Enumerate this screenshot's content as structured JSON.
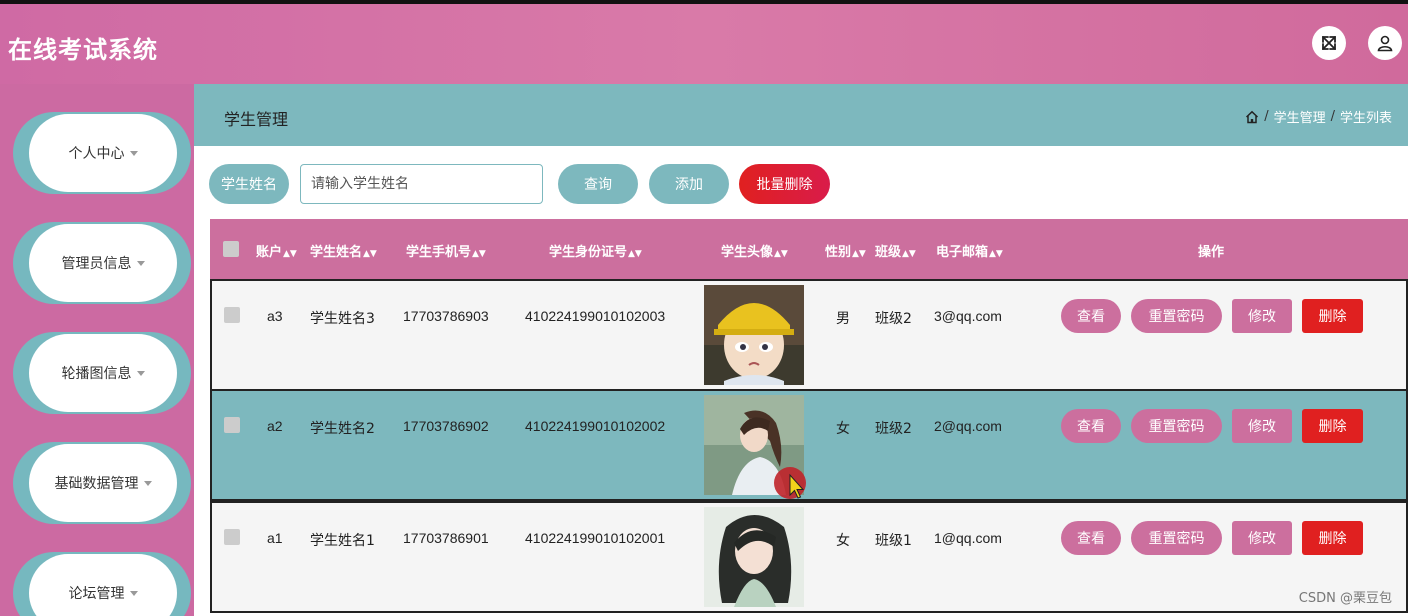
{
  "app": {
    "title": "在线考试系统"
  },
  "header": {
    "fullscreen_icon": "expand-icon",
    "user_icon": "user-icon"
  },
  "sidebar": {
    "items": [
      {
        "label": "个人中心"
      },
      {
        "label": "管理员信息"
      },
      {
        "label": "轮播图信息"
      },
      {
        "label": "基础数据管理"
      },
      {
        "label": "论坛管理"
      }
    ]
  },
  "page": {
    "title": "学生管理",
    "breadcrumb": [
      "学生管理",
      "学生列表"
    ]
  },
  "search": {
    "label": "学生姓名",
    "placeholder": "请输入学生姓名",
    "query_label": "查询",
    "add_label": "添加",
    "batch_delete_label": "批量删除"
  },
  "table": {
    "headers": {
      "account": "账户",
      "name": "学生姓名",
      "phone": "学生手机号",
      "id_card": "学生身份证号",
      "avatar": "学生头像",
      "gender": "性别",
      "class": "班级",
      "email": "电子邮箱",
      "actions": "操作"
    },
    "actions": {
      "view": "查看",
      "reset": "重置密码",
      "edit": "修改",
      "delete": "删除"
    },
    "rows": [
      {
        "account": "a3",
        "name": "学生姓名3",
        "phone": "17703786903",
        "id_card": "410224199010102003",
        "gender": "男",
        "class": "班级2",
        "email": "3@qq.com"
      },
      {
        "account": "a2",
        "name": "学生姓名2",
        "phone": "17703786902",
        "id_card": "410224199010102002",
        "gender": "女",
        "class": "班级2",
        "email": "2@qq.com"
      },
      {
        "account": "a1",
        "name": "学生姓名1",
        "phone": "17703786901",
        "id_card": "410224199010102001",
        "gender": "女",
        "class": "班级1",
        "email": "1@qq.com"
      }
    ]
  },
  "watermark": "CSDN @栗豆包",
  "colors": {
    "pink": "#cc6f9e",
    "teal": "#7db8be",
    "red": "#e02020"
  }
}
